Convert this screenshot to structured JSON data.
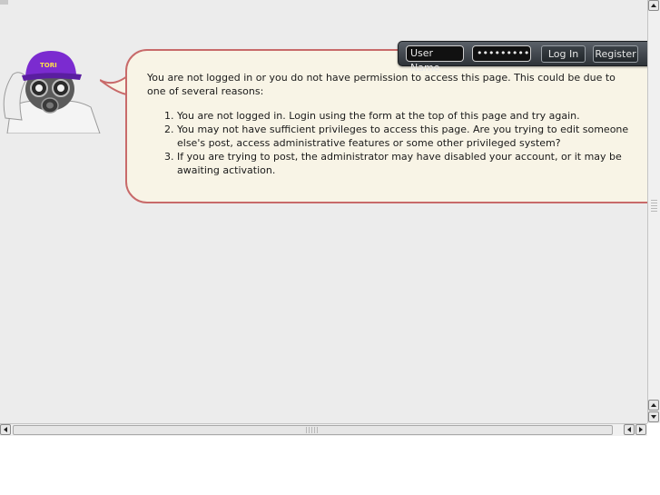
{
  "login": {
    "username_value": "User Name",
    "password_value": "•••••••••",
    "login_label": "Log In",
    "register_label": "Register"
  },
  "mascot": {
    "cap_text": "TORI"
  },
  "message": {
    "intro": "You are not logged in or you do not have permission to access this page. This could be due to one of several reasons:",
    "reasons": [
      "You are not logged in. Login using the form at the top of this page and try again.",
      "You may not have sufficient privileges to access this page. Are you trying to edit someone else's post, access administrative features or some other privileged system?",
      "If you are trying to post, the administrator may have disabled your account, or it may be awaiting activation."
    ]
  },
  "colors": {
    "page_bg": "#ececec",
    "bubble_bg": "#f8f4e6",
    "bubble_border": "#c86a6a",
    "login_bar": "#2e3338",
    "cap": "#7b2bd0"
  },
  "icons": {
    "scroll_up": "arrow-up-icon",
    "scroll_down": "arrow-down-icon",
    "scroll_left": "arrow-left-icon",
    "scroll_right": "arrow-right-icon"
  }
}
